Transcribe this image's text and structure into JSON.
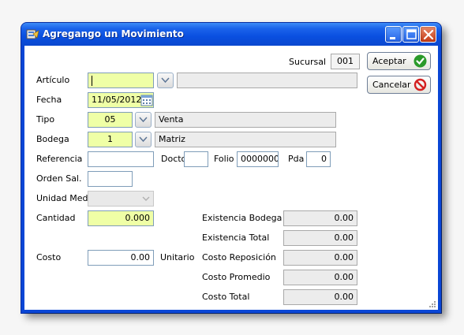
{
  "window": {
    "title": "Agregango un Movimiento",
    "titlebar_color": "#0a4fe0"
  },
  "titlebar_buttons": {
    "minimize_icon": "minimize-icon",
    "maximize_icon": "maximize-icon",
    "close_icon": "close-icon"
  },
  "sucursal": {
    "label": "Sucursal",
    "value": "001"
  },
  "buttons": {
    "accept_label": "Aceptar",
    "cancel_label": "Cancelar"
  },
  "form": {
    "articulo": {
      "label": "Artículo",
      "value": "",
      "description": ""
    },
    "fecha": {
      "label": "Fecha",
      "value": "11/05/2012"
    },
    "tipo": {
      "label": "Tipo",
      "value": "05",
      "description": "Venta"
    },
    "bodega": {
      "label": "Bodega",
      "value": "1",
      "description": "Matriz"
    },
    "referencia": {
      "label": "Referencia",
      "value": ""
    },
    "docto": {
      "label": "Docto",
      "value": ""
    },
    "folio": {
      "label": "Folio",
      "value": "0000000"
    },
    "pda": {
      "label": "Pda",
      "value": "0"
    },
    "orden_sal": {
      "label": "Orden Sal.",
      "value": ""
    },
    "unidad_med": {
      "label": "Unidad Med.",
      "value": ""
    },
    "cantidad": {
      "label": "Cantidad",
      "value": "0.000"
    },
    "costo": {
      "label": "Costo",
      "value": "0.00",
      "unit_label": "Unitario"
    }
  },
  "stats": {
    "existencia_bodega": {
      "label": "Existencia Bodega",
      "value": "0.00"
    },
    "existencia_total": {
      "label": "Existencia Total",
      "value": "0.00"
    },
    "costo_reposicion": {
      "label": "Costo Reposición",
      "value": "0.00"
    },
    "costo_promedio": {
      "label": "Costo Promedio",
      "value": "0.00"
    },
    "costo_total": {
      "label": "Costo Total",
      "value": "0.00"
    }
  },
  "colors": {
    "required_field": "#efffa6",
    "readonly_field": "#ececec",
    "accept_icon": "#2a9a2a",
    "cancel_icon": "#d42020"
  }
}
